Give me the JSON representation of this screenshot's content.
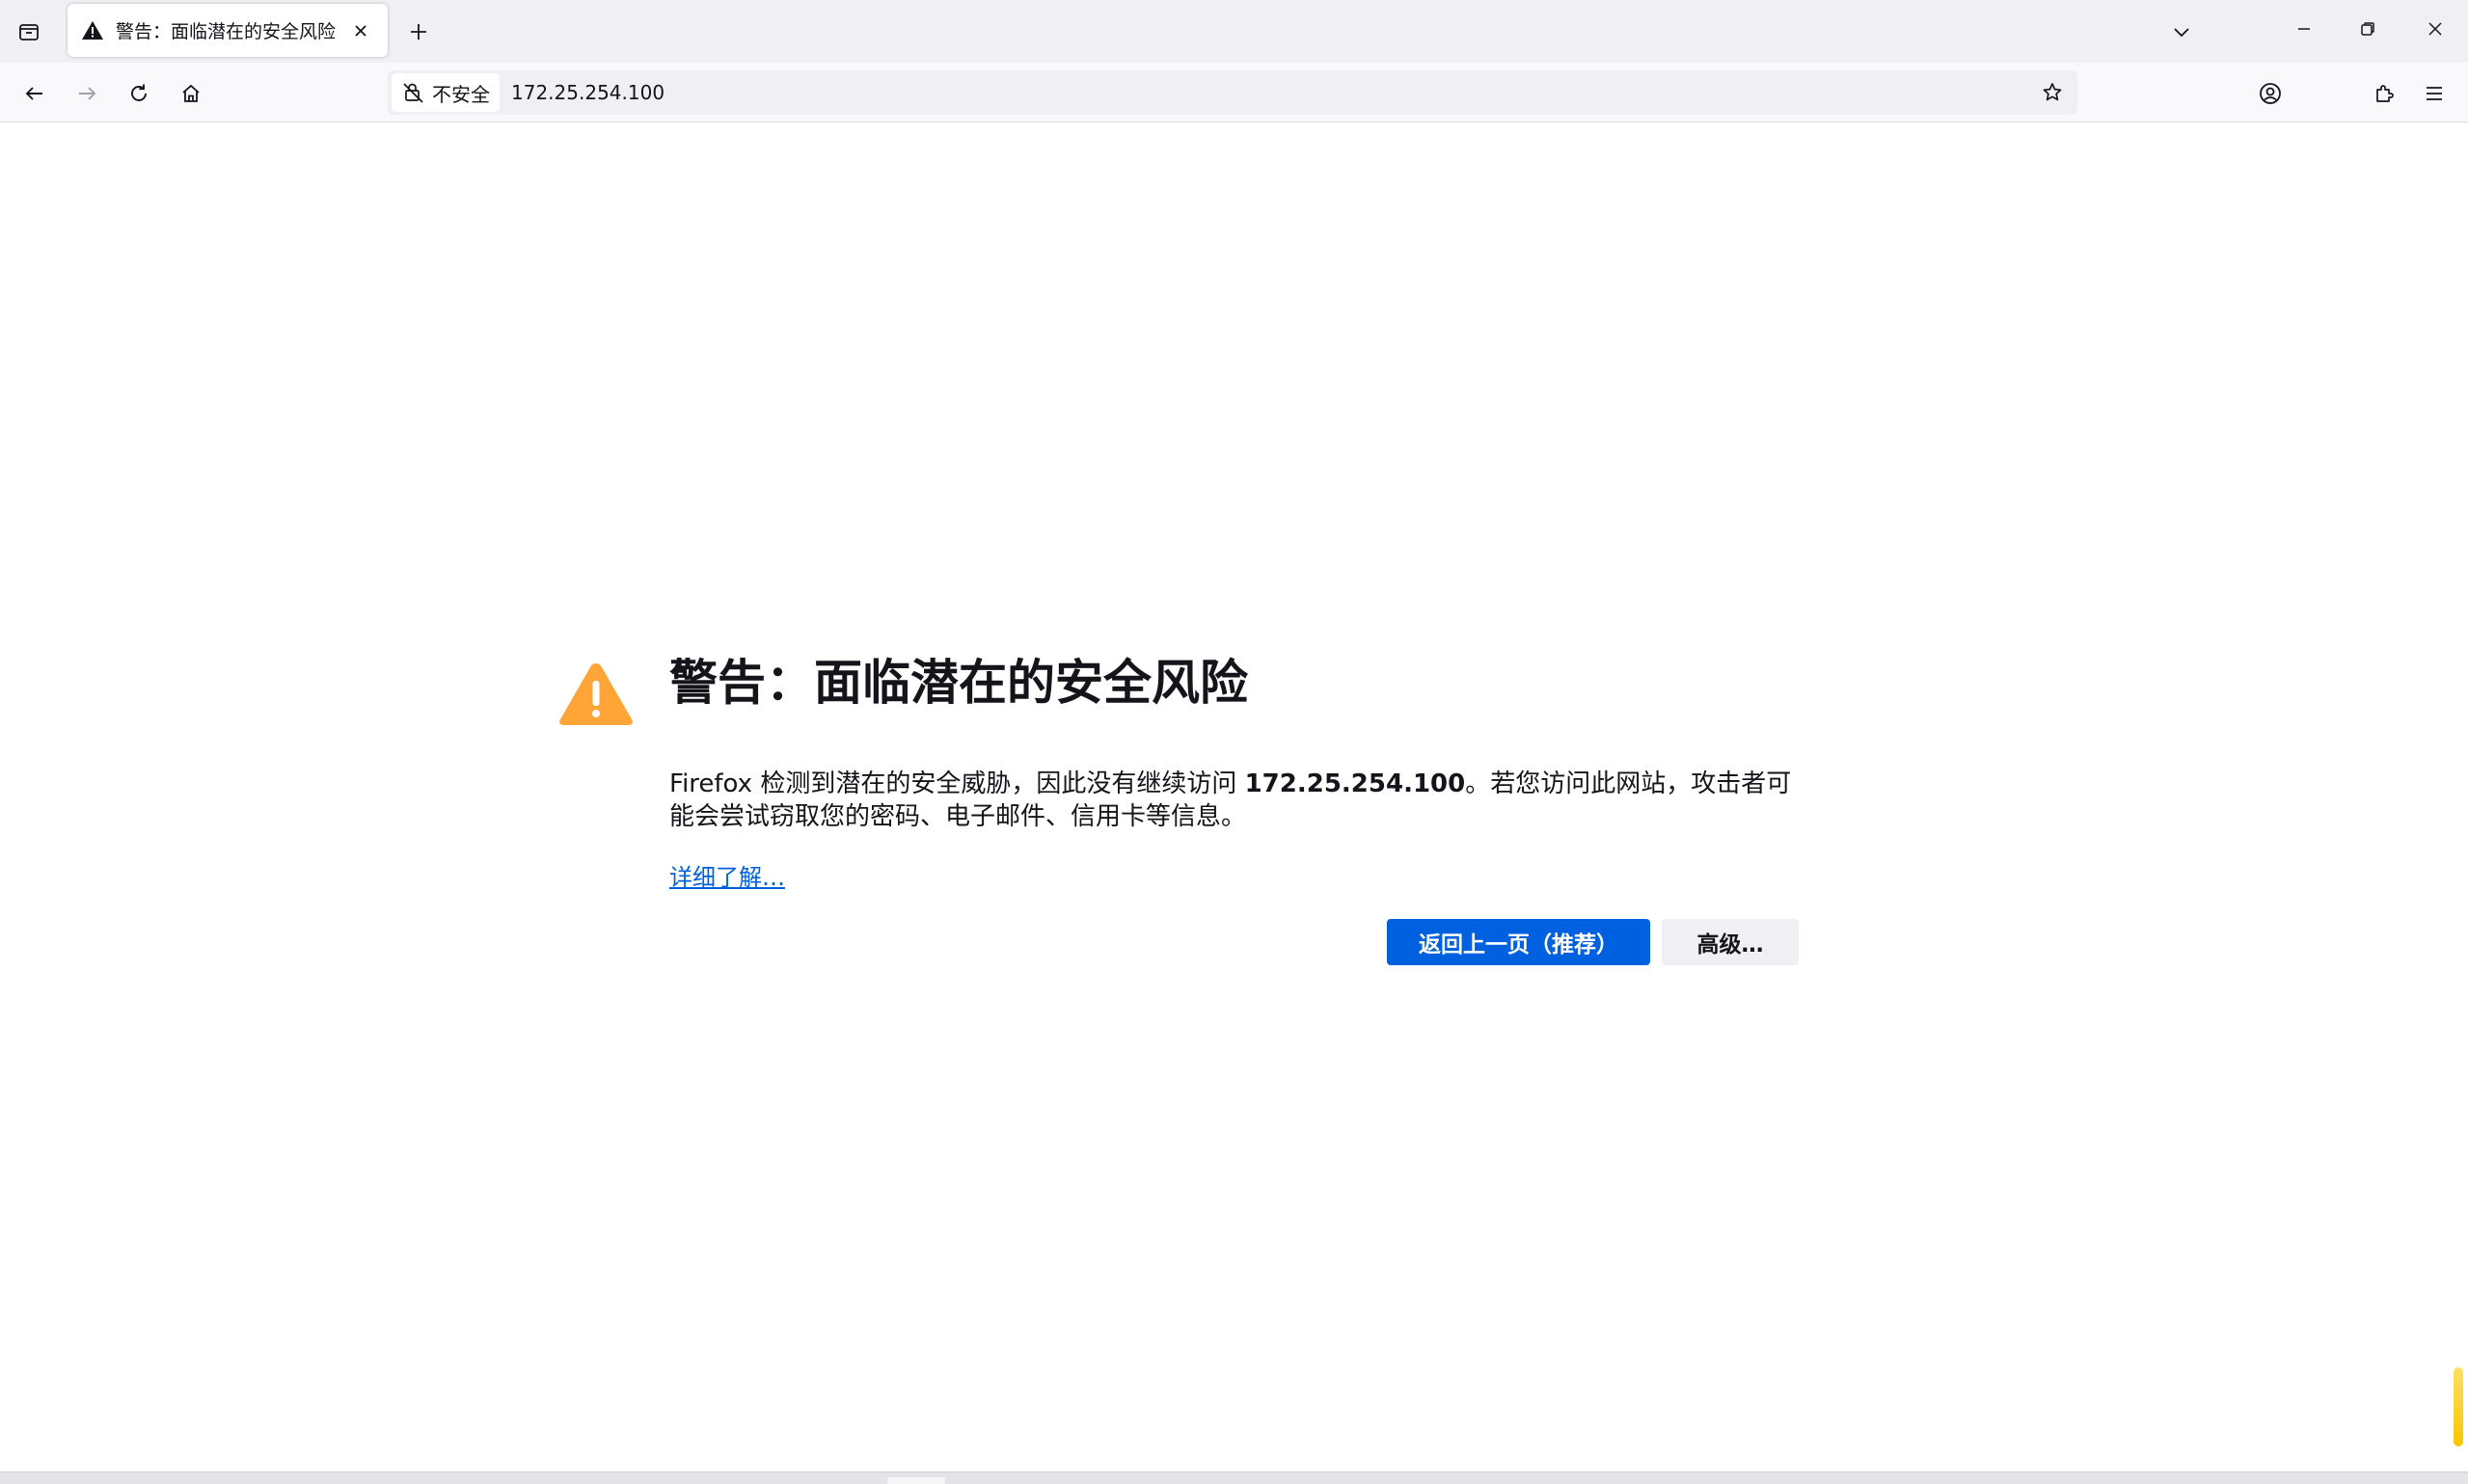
{
  "browser": {
    "tab": {
      "title": "警告：面临潜在的安全风险",
      "icon": "warning-icon"
    },
    "icons": {
      "tab_list": "tab-list-icon",
      "new_tab": "plus-icon",
      "tab_overflow": "chevron-down-icon",
      "minimize": "minimize-icon",
      "restore": "restore-icon",
      "close": "close-icon",
      "back": "arrow-left-icon",
      "forward": "arrow-right-icon",
      "reload": "reload-icon",
      "home": "home-icon",
      "bookmark": "star-icon",
      "account": "account-icon",
      "extensions": "puzzle-icon",
      "menu": "hamburger-icon"
    },
    "urlbar": {
      "security_label": "不安全",
      "url": "172.25.254.100"
    }
  },
  "page": {
    "title": "警告：面临潜在的安全风险",
    "description_prefix": "Firefox 检测到潜在的安全威胁，因此没有继续访问 ",
    "description_host": "172.25.254.100",
    "description_suffix": "。若您访问此网站，攻击者可能会尝试窃取您的密码、电子邮件、信用卡等信息。",
    "learn_more": "详细了解…",
    "go_back_button": "返回上一页（推荐）",
    "advanced_button": "高级…"
  },
  "colors": {
    "accent_blue": "#0061e0",
    "warning_orange": "#ffa436",
    "text": "#15141a"
  }
}
